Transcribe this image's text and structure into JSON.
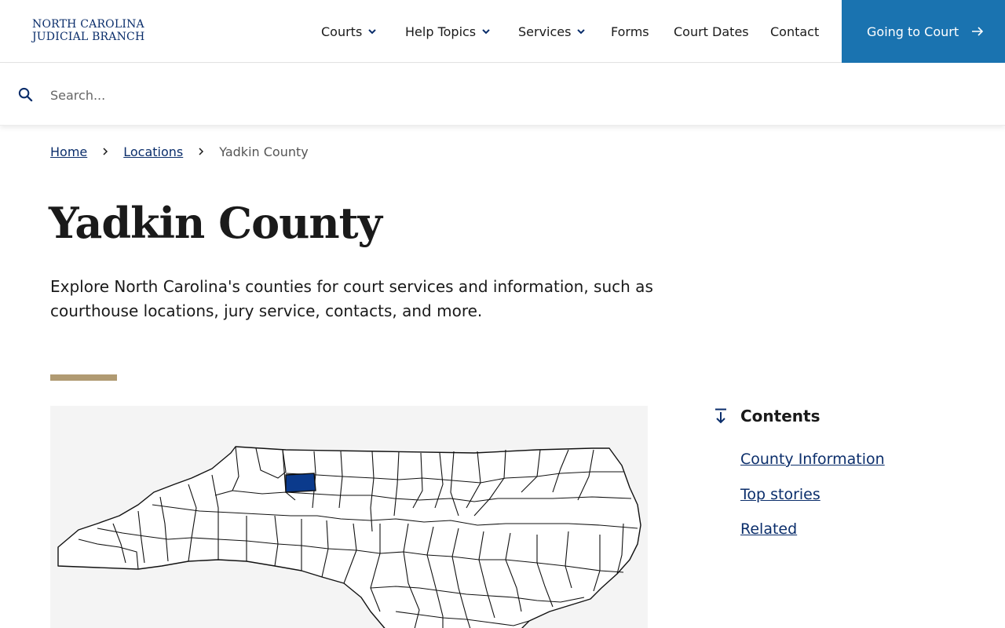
{
  "header": {
    "logo_line1": "North Carolina",
    "logo_line2": "Judicial Branch",
    "nav": [
      {
        "label": "Courts",
        "has_menu": true
      },
      {
        "label": "Help Topics",
        "has_menu": true
      },
      {
        "label": "Services",
        "has_menu": true
      },
      {
        "label": "Forms",
        "has_menu": false
      },
      {
        "label": "Court Dates",
        "has_menu": false
      },
      {
        "label": "Contact",
        "has_menu": false
      }
    ],
    "cta_label": "Going to Court"
  },
  "search": {
    "placeholder": "Search...",
    "value": ""
  },
  "breadcrumb": {
    "items": [
      "Home",
      "Locations"
    ],
    "current": "Yadkin County"
  },
  "page": {
    "title": "Yadkin County",
    "intro": "Explore North Carolina's counties for court services and information, such as courthouse locations, jury service, contacts, and more."
  },
  "contents": {
    "title": "Contents",
    "items": [
      "County Information",
      "Top stories",
      "Related"
    ]
  },
  "colors": {
    "brand_navy": "#0b2e6b",
    "cta_blue": "#1a73b0",
    "accent_rule": "#b09a72",
    "map_highlight": "#0b3a8c"
  },
  "icons": {
    "search": "search-icon",
    "chevron": "chevron-down-icon",
    "cta_arrow": "arrow-right-icon",
    "contents": "jump-down-icon"
  }
}
